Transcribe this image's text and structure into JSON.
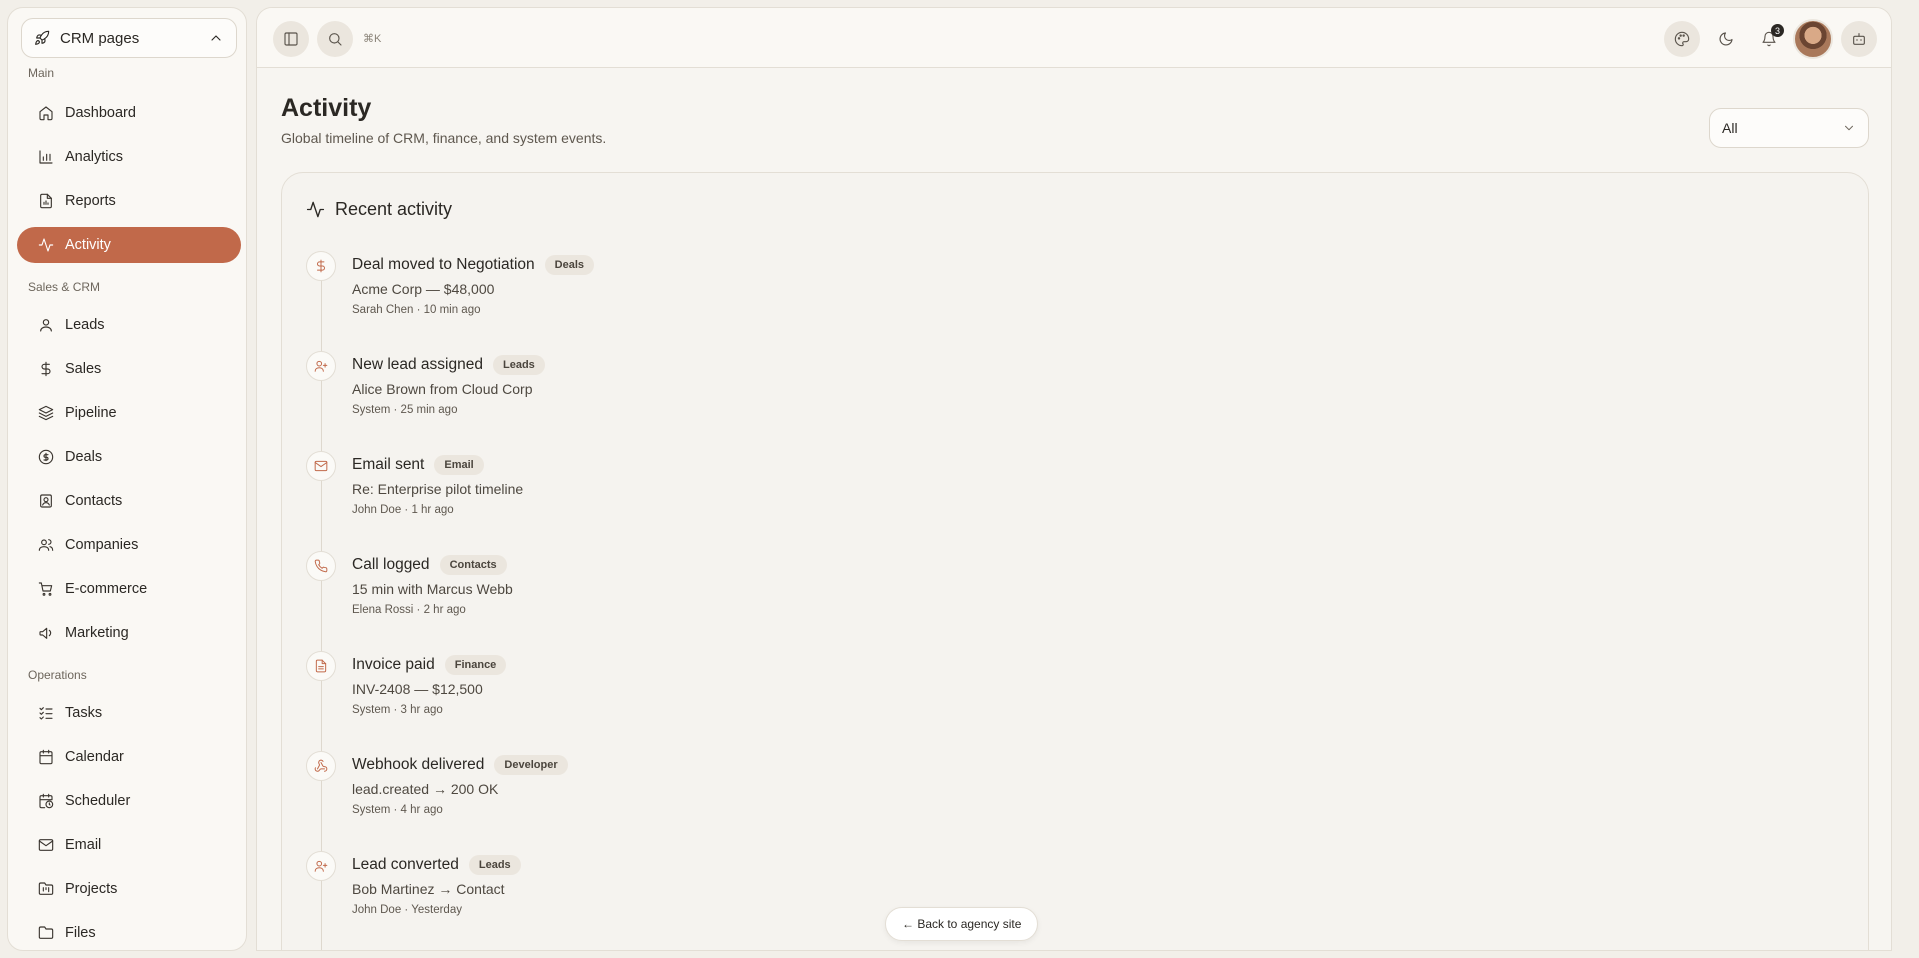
{
  "sidebar": {
    "workspace": "CRM pages",
    "sections": {
      "main": "Main",
      "sales": "Sales & CRM",
      "operations": "Operations"
    },
    "items": {
      "dashboard": "Dashboard",
      "analytics": "Analytics",
      "reports": "Reports",
      "activity": "Activity",
      "leads": "Leads",
      "sales": "Sales",
      "pipeline": "Pipeline",
      "deals": "Deals",
      "contacts": "Contacts",
      "companies": "Companies",
      "ecommerce": "E-commerce",
      "marketing": "Marketing",
      "tasks": "Tasks",
      "calendar": "Calendar",
      "scheduler": "Scheduler",
      "email": "Email",
      "projects": "Projects",
      "files": "Files"
    },
    "active": "activity"
  },
  "topbar": {
    "shortcut": "⌘K",
    "notification_count": "3"
  },
  "header": {
    "title": "Activity",
    "subtitle": "Global timeline of CRM, finance, and system events.",
    "filter_value": "All"
  },
  "activity_card": {
    "title": "Recent activity",
    "events": [
      {
        "icon": "dollar-icon",
        "title": "Deal moved to Negotiation",
        "tag": "Deals",
        "desc": "Acme Corp — $48,000",
        "meta": "Sarah Chen · 10 min ago"
      },
      {
        "icon": "user-plus-icon",
        "title": "New lead assigned",
        "tag": "Leads",
        "desc": "Alice Brown from Cloud Corp",
        "meta": "System · 25 min ago"
      },
      {
        "icon": "mail-icon",
        "title": "Email sent",
        "tag": "Email",
        "desc": "Re: Enterprise pilot timeline",
        "meta": "John Doe · 1 hr ago"
      },
      {
        "icon": "phone-icon",
        "title": "Call logged",
        "tag": "Contacts",
        "desc": "15 min with Marcus Webb",
        "meta": "Elena Rossi · 2 hr ago"
      },
      {
        "icon": "file-icon",
        "title": "Invoice paid",
        "tag": "Finance",
        "desc": "INV-2408 — $12,500",
        "meta": "System · 3 hr ago"
      },
      {
        "icon": "webhook-icon",
        "title": "Webhook delivered",
        "tag": "Developer",
        "desc": "lead.created → 200 OK",
        "meta": "System · 4 hr ago"
      },
      {
        "icon": "user-plus-icon",
        "title": "Lead converted",
        "tag": "Leads",
        "desc": "Bob Martinez → Contact",
        "meta": "John Doe · Yesterday"
      }
    ]
  },
  "back_button": "← Back to agency site",
  "colors": {
    "accent": "#c1694a",
    "background": "#f2efe9",
    "panel": "#faf8f4"
  }
}
